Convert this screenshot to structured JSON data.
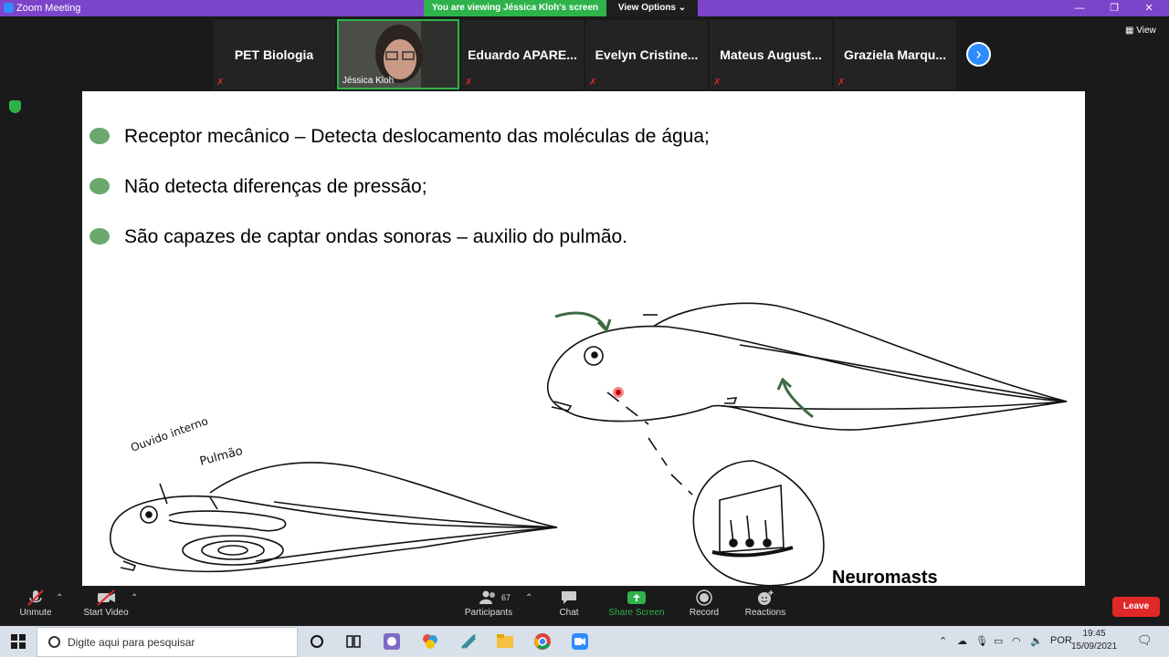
{
  "window": {
    "title": "Zoom Meeting",
    "viewing_banner": "You are viewing Jéssica Kloh's screen",
    "view_options": "View Options",
    "minimize": "—",
    "maximize": "❐",
    "close": "✕"
  },
  "participants_strip": {
    "tiles": [
      {
        "name": "PET Biologia"
      },
      {
        "name": "Jéssica Kloh"
      },
      {
        "name": "Eduardo APARE..."
      },
      {
        "name": "Evelyn Cristine..."
      },
      {
        "name": "Mateus August..."
      },
      {
        "name": "Graziela Marqu..."
      }
    ],
    "next": "›",
    "view_label": "View"
  },
  "slide": {
    "bullets": [
      "Receptor mecânico – Detecta deslocamento das moléculas de água;",
      "Não detecta diferenças de pressão;",
      "São capazes de captar ondas sonoras – auxilio do pulmão."
    ],
    "handwritten_labels": [
      "Ouvido interno",
      "Pulmão"
    ],
    "neuromasts_label": "Neuromasts"
  },
  "toolbar": {
    "unmute": "Unmute",
    "start_video": "Start Video",
    "participants": "Participants",
    "participants_count": "67",
    "chat": "Chat",
    "share_screen": "Share Screen",
    "record": "Record",
    "reactions": "Reactions",
    "leave": "Leave"
  },
  "taskbar": {
    "search_placeholder": "Digite aqui para pesquisar",
    "language": "POR",
    "time": "19:45",
    "date": "15/09/2021"
  },
  "colors": {
    "zoom_titlebar": "#7b44c9",
    "share_green": "#2eb34b",
    "zoom_blue": "#2d8cff",
    "leave_red": "#e02828",
    "bullet_green": "#6aa86d"
  }
}
